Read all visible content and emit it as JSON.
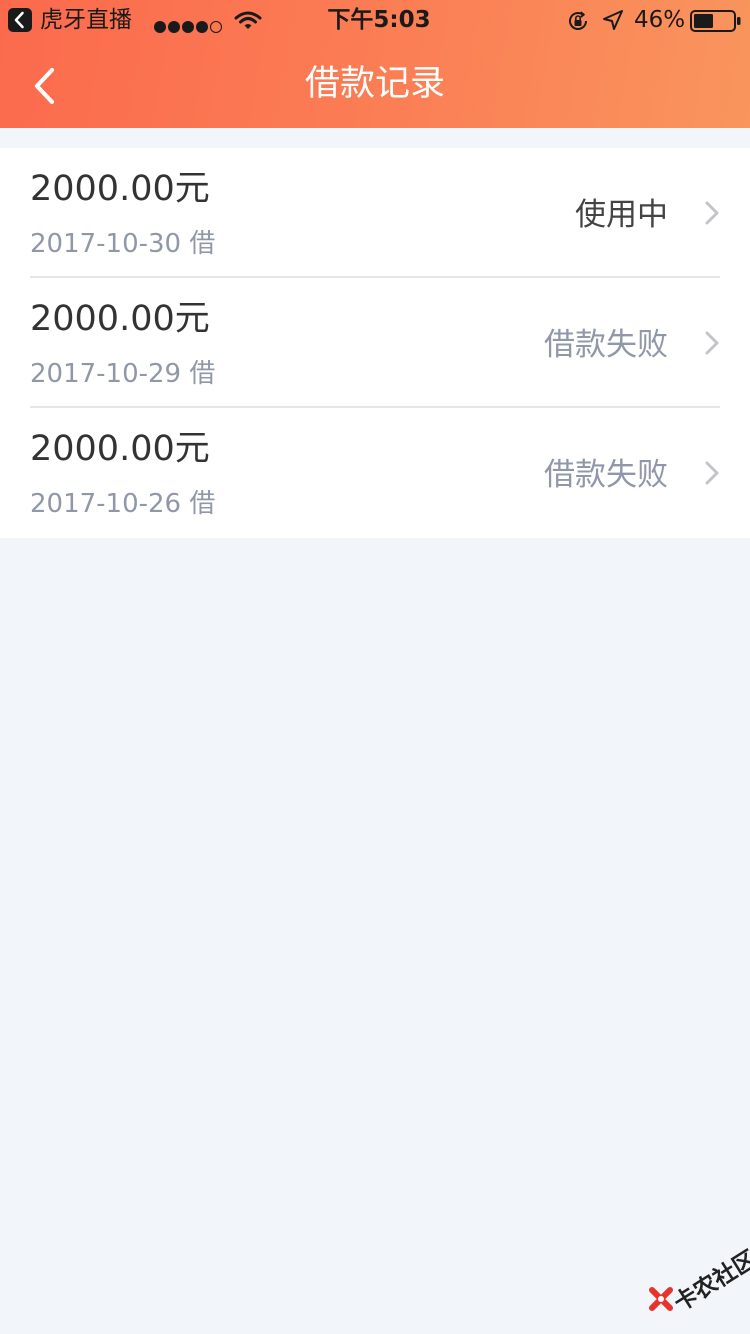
{
  "status_bar": {
    "back_app": "虎牙直播",
    "time": "下午5:03",
    "battery": "46%"
  },
  "nav": {
    "title": "借款记录"
  },
  "records": [
    {
      "amount": "2000.00元",
      "date": "2017-10-30 借",
      "status": "使用中"
    },
    {
      "amount": "2000.00元",
      "date": "2017-10-29 借",
      "status": "借款失败"
    },
    {
      "amount": "2000.00元",
      "date": "2017-10-26 借",
      "status": "借款失败"
    }
  ],
  "watermark": {
    "text": "卡农社区"
  },
  "colors": {
    "header_start": "#fb6a4d",
    "header_end": "#f9955d",
    "background": "#f2f6fa",
    "status_active": "#444444",
    "status_failed": "#9098a8"
  }
}
